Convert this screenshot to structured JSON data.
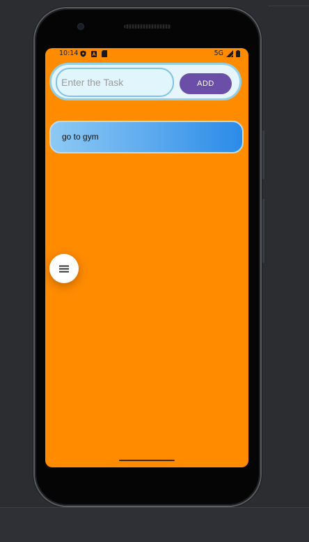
{
  "status_bar": {
    "time": "10:14",
    "network": "5G",
    "left_icons": [
      "shield-icon",
      "font-icon",
      "sd-card-icon"
    ],
    "right_icons": [
      "signal-icon",
      "battery-icon"
    ]
  },
  "task_form": {
    "input_placeholder": "Enter the Task",
    "input_value": "",
    "add_label": "ADD"
  },
  "tasks": [
    {
      "text": "go to gym"
    }
  ],
  "fab": {
    "icon": "menu-icon"
  },
  "colors": {
    "screen_background": "#ff8c00",
    "add_button": "#6a4ea8",
    "input_border": "#7ec3e7",
    "task_gradient_start": "#8dc9f4",
    "task_gradient_end": "#2a8be8"
  }
}
